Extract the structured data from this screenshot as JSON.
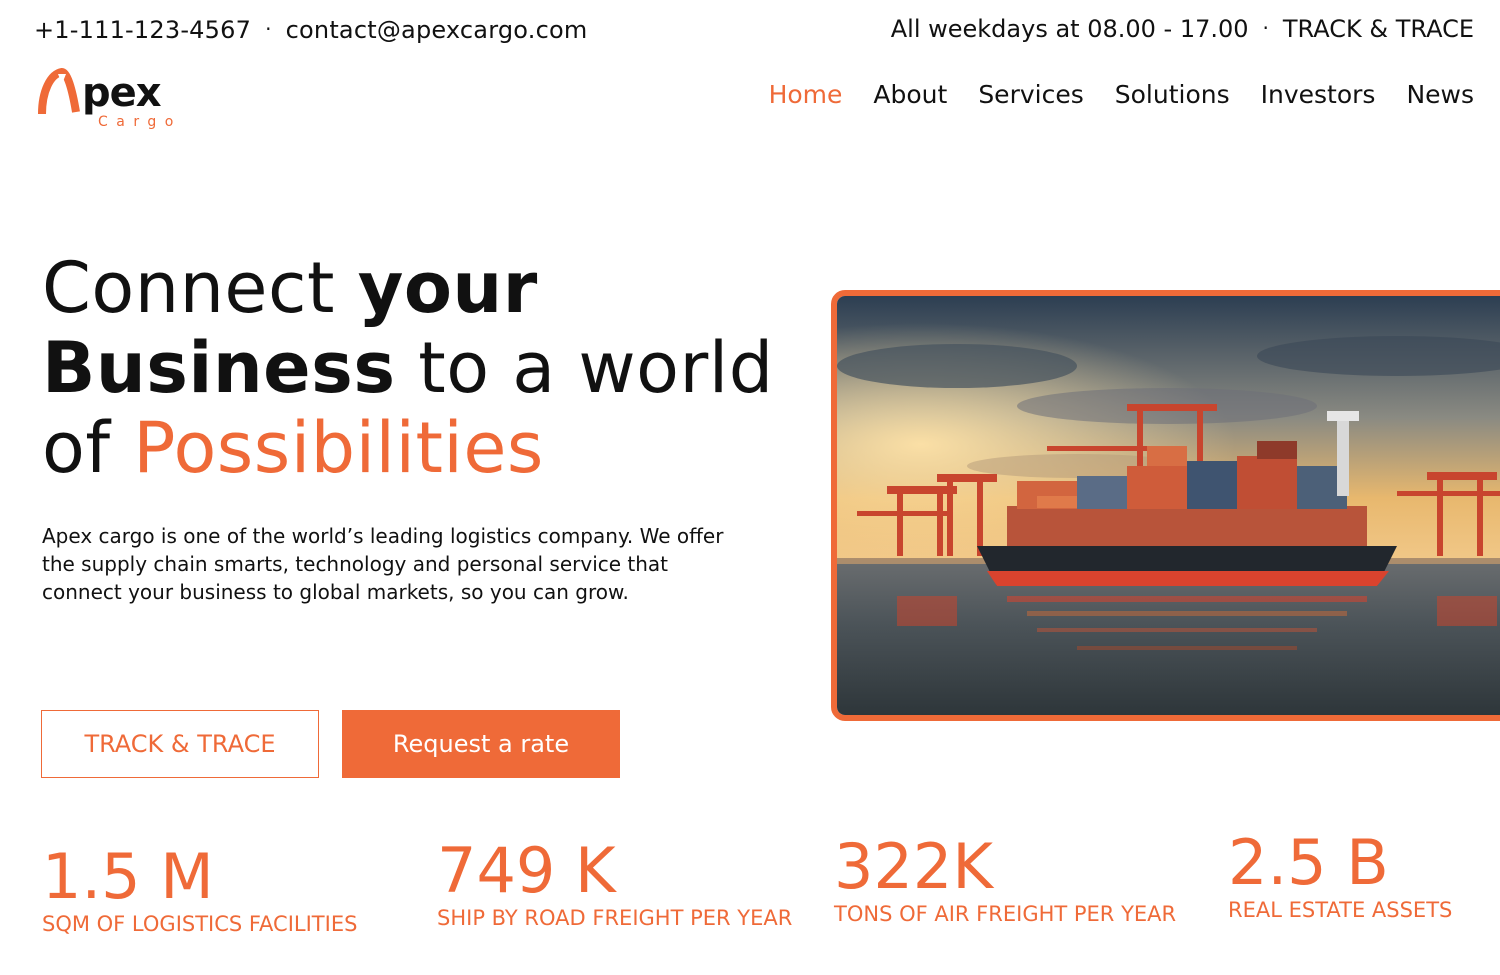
{
  "topbar": {
    "phone": "+1-111-123-4567",
    "email": "contact@apexcargo.com",
    "hours": "All weekdays at 08.00 - 17.00",
    "track_link": "TRACK & TRACE",
    "separator": "·"
  },
  "logo": {
    "wordmark": "pex",
    "subtitle": "Cargo",
    "icon": "arch-a-icon"
  },
  "nav": {
    "items": [
      {
        "label": "Home",
        "active": true
      },
      {
        "label": "About",
        "active": false
      },
      {
        "label": "Services",
        "active": false
      },
      {
        "label": "Solutions",
        "active": false
      },
      {
        "label": "Investors",
        "active": false
      },
      {
        "label": "News",
        "active": false
      }
    ]
  },
  "hero": {
    "title": {
      "line1_regular": "Connect ",
      "line1_bold": "your",
      "line2_bold": "Business",
      "line2_regular": " to a world",
      "line3_regular": "of ",
      "line3_accent": "Possibilities"
    },
    "description": "Apex cargo is one of the world’s leading logistics company. We offer the supply chain smarts, technology and personal service that connect your business to global markets, so you can grow.",
    "buttons": {
      "track": "TRACK & TRACE",
      "rate": "Request a rate"
    }
  },
  "stats": [
    {
      "value": "1.5 M",
      "label": "SQM OF LOGISTICS FACILITIES"
    },
    {
      "value": "749 K",
      "label": "SHIP BY ROAD FREIGHT PER YEAR"
    },
    {
      "value": "322K",
      "label": "TONS OF AIR FREIGHT PER YEAR"
    },
    {
      "value": "2.5 B",
      "label": "REAL ESTATE ASSETS"
    }
  ],
  "colors": {
    "accent": "#ef6a38",
    "text": "#111111",
    "background": "#ffffff"
  }
}
